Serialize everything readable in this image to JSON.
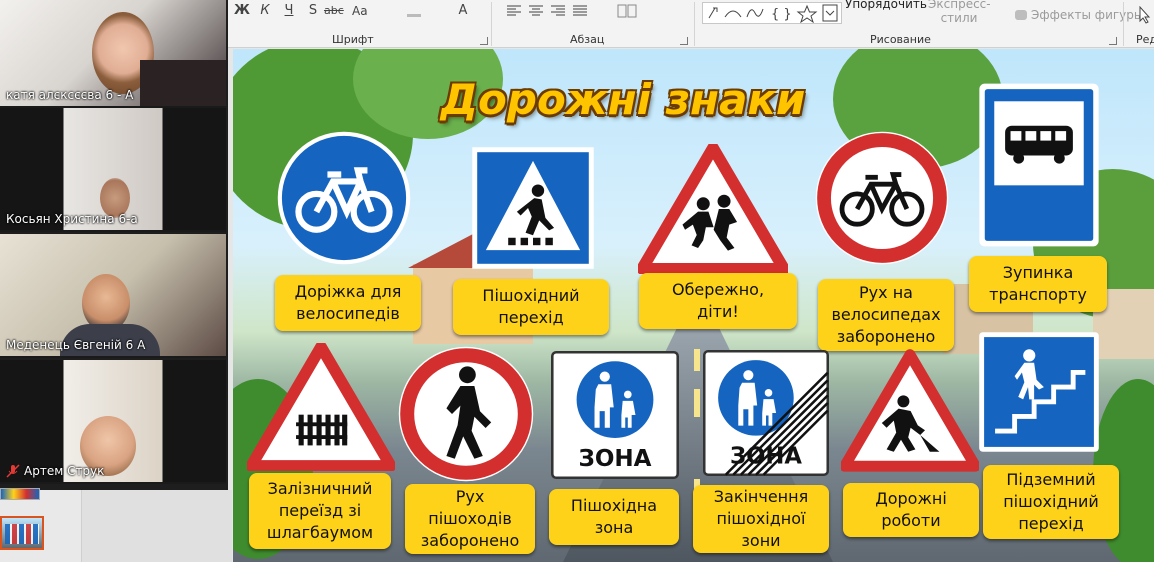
{
  "ribbon": {
    "font_buttons": [
      "Ж",
      "К",
      "Ч",
      "S",
      "abc",
      "Aa",
      "A"
    ],
    "font_group_label": "Шрифт",
    "paragraph_group_label": "Абзац",
    "drawing_group_label": "Рисование",
    "arrange_label": "Упорядочить",
    "quick_styles_label": "Экспресс-\nстили",
    "shape_effects_label": "Эффекты фигуры",
    "editing_group_label": "Ред"
  },
  "participants": [
    {
      "name": "катя алєксєєва 6 - А",
      "muted": false
    },
    {
      "name": "Косьян Христина 6-а",
      "muted": false
    },
    {
      "name": "Меденець Євгеній 6 А",
      "muted": false
    },
    {
      "name": "Артем Струк",
      "muted": true
    }
  ],
  "slide": {
    "title": "Дорожні знаки",
    "signs": [
      {
        "icon": "bicycle-lane-sign-icon",
        "label": "Доріжка для\nвелосипедів"
      },
      {
        "icon": "pedestrian-crossing-sign-icon",
        "label": "Пішохідний\nперехід"
      },
      {
        "icon": "children-warning-sign-icon",
        "label": "Обережно,\nдіти!"
      },
      {
        "icon": "no-bicycles-sign-icon",
        "label": "Рух на\nвелосипедах\nзаборонено"
      },
      {
        "icon": "bus-stop-sign-icon",
        "label": "Зупинка\nтранспорту"
      },
      {
        "icon": "railway-crossing-sign-icon",
        "label": "Залізничний\nпереїзд зі\nшлагбаумом"
      },
      {
        "icon": "no-pedestrians-sign-icon",
        "label": "Рух\nпішоходів\nзаборонено"
      },
      {
        "icon": "pedestrian-zone-sign-icon",
        "label": "Пішохідна\nзона",
        "sign_text": "ЗОНА"
      },
      {
        "icon": "end-pedestrian-zone-sign-icon",
        "label": "Закінчення\nпішохідної\nзони",
        "sign_text": "ЗОНА"
      },
      {
        "icon": "road-works-sign-icon",
        "label": "Дорожні\nроботи"
      },
      {
        "icon": "underground-crossing-sign-icon",
        "label": "Підземний\nпішохідний\nперехід"
      }
    ]
  },
  "colors": {
    "sign_blue": "#1565c0",
    "sign_red": "#d32f2f",
    "label_yellow": "#ffd21a",
    "title_yellow": "#ffc400"
  }
}
